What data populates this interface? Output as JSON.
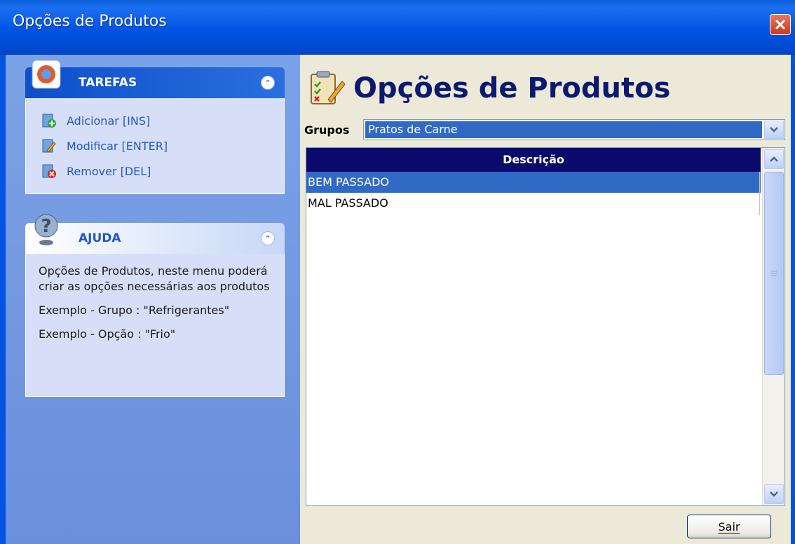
{
  "window": {
    "title": "Opções de Produtos",
    "close_icon": "close-icon"
  },
  "sidebar": {
    "tarefas": {
      "title": "TAREFAS",
      "items": [
        {
          "label": "Adicionar [INS]",
          "icon": "add-icon"
        },
        {
          "label": "Modificar [ENTER]",
          "icon": "edit-icon"
        },
        {
          "label": "Remover [DEL]",
          "icon": "remove-icon"
        }
      ]
    },
    "ajuda": {
      "title": "AJUDA",
      "paragraphs": [
        "Opções de Produtos, neste menu poderá criar as opções necessárias aos produtos",
        "Exemplo - Grupo : \"Refrigerantes\"",
        "Exemplo - Opção : \"Frio\""
      ]
    }
  },
  "main": {
    "heading": "Opções de Produtos",
    "grupos_label": "Grupos",
    "grupos_value": "Pratos de Carne",
    "grid": {
      "column": "Descrição",
      "rows": [
        "BEM PASSADO",
        "MAL PASSADO"
      ],
      "selected_index": 0
    },
    "sair_label": "Sair"
  },
  "colors": {
    "title_bar": "#0054e3",
    "sidebar": "#7ba2e7",
    "selection": "#316ac5",
    "grid_header": "#0a0a6c"
  }
}
